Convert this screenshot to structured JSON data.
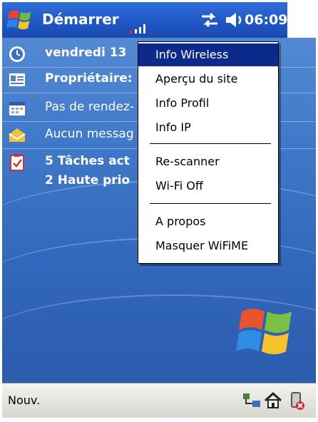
{
  "taskbar": {
    "start_label": "Démarrer",
    "time": "06:09"
  },
  "today": {
    "date": "vendredi 13",
    "owner": "Propriétaire:",
    "appointments": "Pas de rendez-",
    "messages": "Aucun messag",
    "tasks_line1": "5 Tâches act",
    "tasks_line2": "2 Haute prio"
  },
  "menu": {
    "items": [
      {
        "label": "Info Wireless",
        "selected": true
      },
      {
        "label": "Aperçu du site"
      },
      {
        "label": "Info Profil"
      },
      {
        "label": "Info IP"
      },
      {
        "label": "Re-scanner"
      },
      {
        "label": "Wi-Fi Off"
      },
      {
        "label": "A propos"
      },
      {
        "label": "Masquer WiFiME"
      }
    ]
  },
  "bottom": {
    "new_label": "Nouv."
  },
  "colors": {
    "accent": "#1f56c3",
    "selection": "#0b2a8c"
  }
}
